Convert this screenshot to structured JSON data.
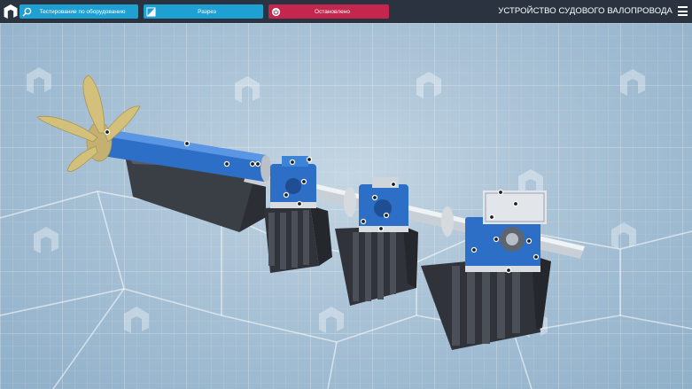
{
  "toolbar": {
    "test_label": "Тестирование по оборудованию",
    "cut_label": "Разрез",
    "stop_label": "Остановлено"
  },
  "header": {
    "title": "УСТРОЙСТВО СУДОВОГО ВАЛОПРОВОДА"
  },
  "icons": {
    "logo": "app-logo-icon",
    "test": "magnifier-wrench-icon",
    "cut": "section-cut-icon",
    "stop": "power-icon",
    "menu": "hamburger-menu-icon"
  },
  "colors": {
    "topbar": "#2b3340",
    "button_blue": "#1fa0d2",
    "button_red": "#c4264e",
    "shaft_blue": "#2d6ec7",
    "propeller": "#d3c07a",
    "floor": "#a9c2d6"
  }
}
